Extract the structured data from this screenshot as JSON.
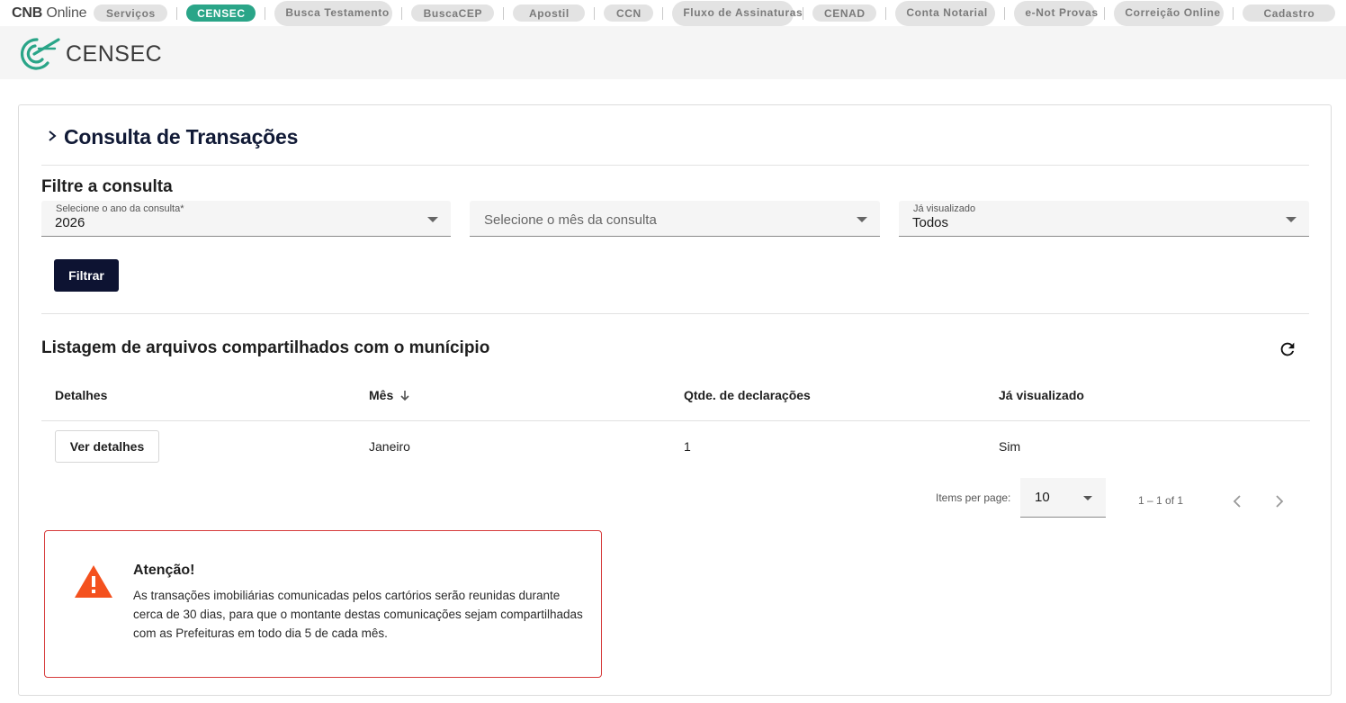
{
  "topbar": {
    "brand_bold": "CNB",
    "brand_rest": " Online",
    "items": [
      {
        "label": "Serviços"
      },
      {
        "label": "CENSEC"
      },
      {
        "label": "Busca Testamento"
      },
      {
        "label": "BuscaCEP"
      },
      {
        "label": "Apostil"
      },
      {
        "label": "CCN"
      },
      {
        "label": "Fluxo de Assinaturas"
      },
      {
        "label": "CENAD"
      },
      {
        "label": "Conta Notarial"
      },
      {
        "label": "e-Not Provas"
      },
      {
        "label": "Correição Online"
      },
      {
        "label": "Cadastro"
      }
    ]
  },
  "header": {
    "logo_text": "CENSEC"
  },
  "page": {
    "title": "Consulta de Transações",
    "filter_title": "Filtre a consulta",
    "filters": {
      "year": {
        "label": "Selecione o ano da consulta*",
        "value": "2026"
      },
      "month": {
        "placeholder": "Selecione o mês da consulta"
      },
      "viewed": {
        "label": "Já visualizado",
        "value": "Todos"
      }
    },
    "filter_button": "Filtrar",
    "list_title": "Listagem de arquivos compartilhados com o munícipio",
    "table": {
      "headers": [
        "Detalhes",
        "Mês",
        "Qtde. de declarações",
        "Já visualizado"
      ],
      "rows": [
        {
          "action": "Ver detalhes",
          "month": "Janeiro",
          "count": "1",
          "viewed": "Sim"
        }
      ]
    },
    "pagination": {
      "items_per_page_label": "Items per page:",
      "items_per_page": "10",
      "range": "1 – 1 of 1"
    },
    "alert": {
      "title": "Atenção!",
      "text": "As transações imobiliárias comunicadas pelos cartórios serão reunidas durante cerca de 30 dias, para que o montante destas comunicações sejam compartilhadas com as Prefeituras em todo dia 5 de cada mês."
    }
  },
  "colors": {
    "primary": "#0d1332",
    "active_pill": "#2aa588",
    "alert_border": "#d63c3c",
    "warning_icon": "#f4511e"
  }
}
